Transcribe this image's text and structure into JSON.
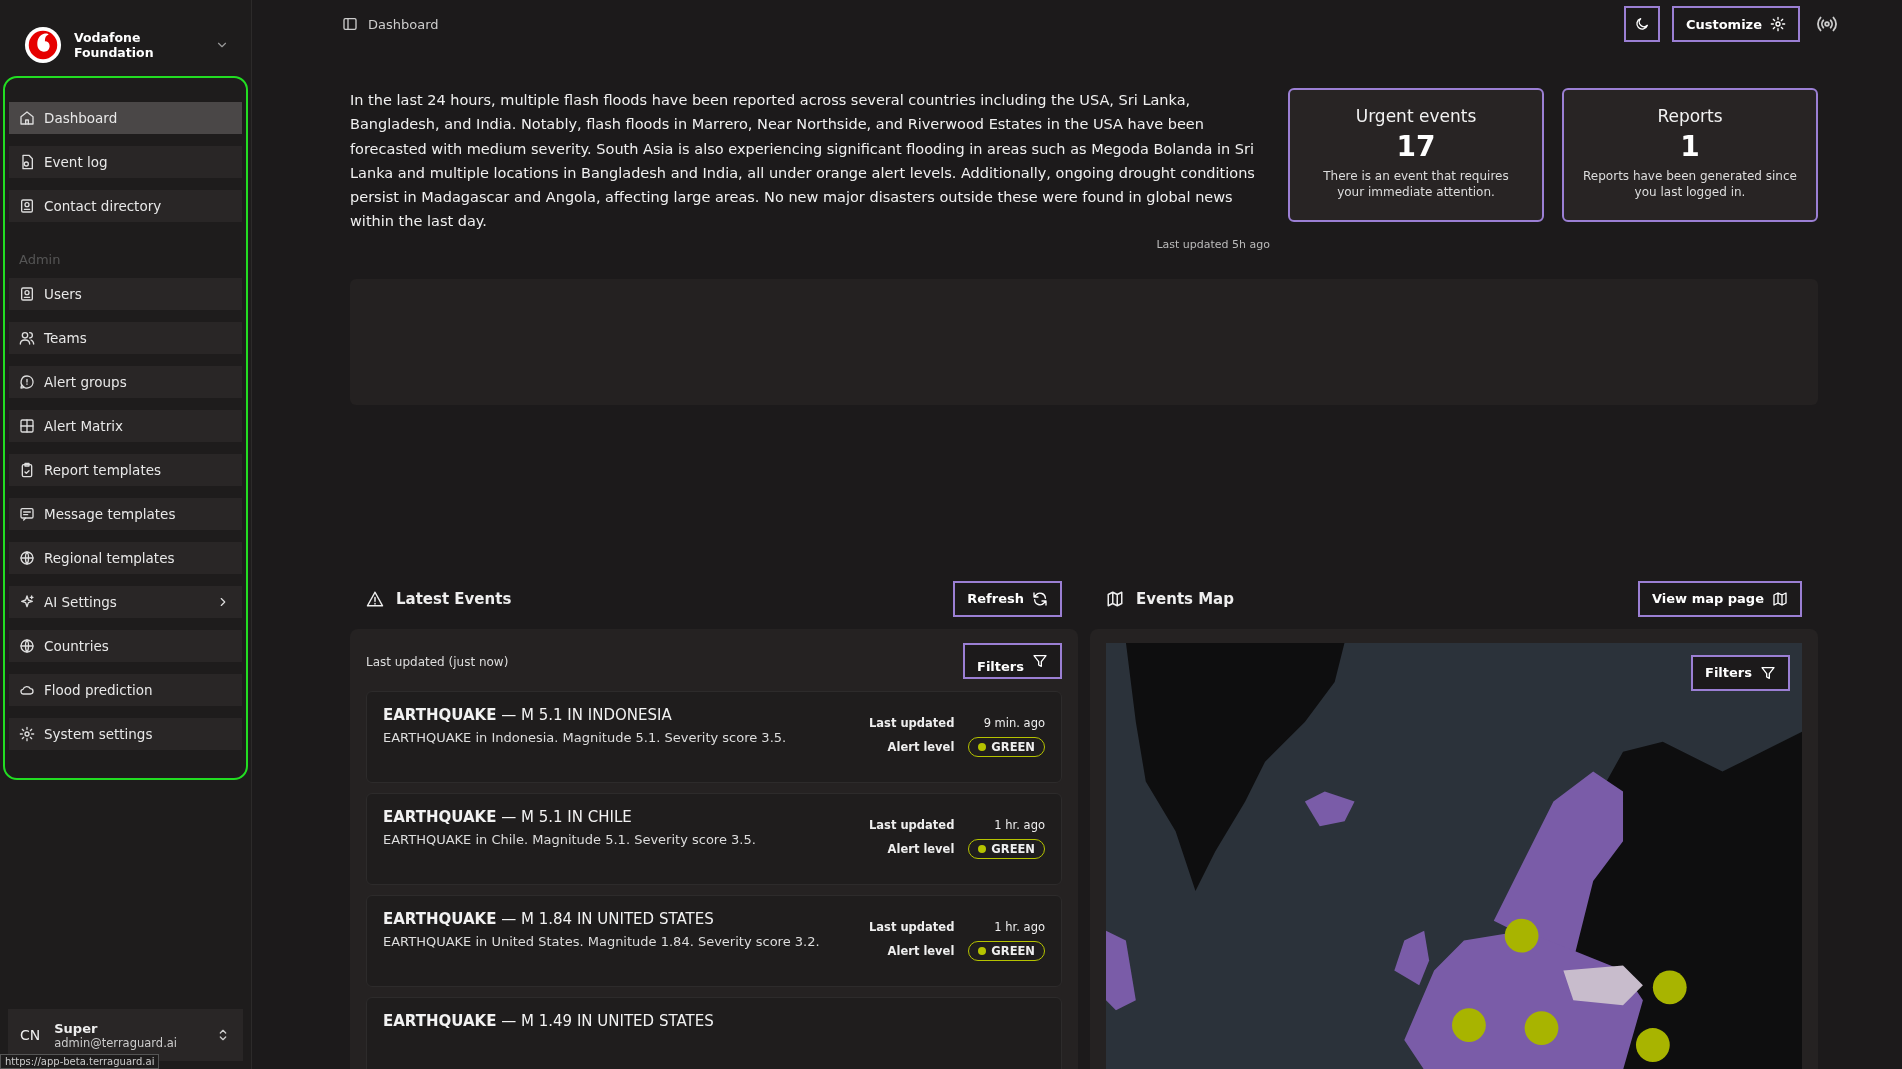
{
  "sidebar": {
    "org_name": "Vodafone Foundation",
    "nav": [
      {
        "label": "Dashboard",
        "selected": true,
        "expandable": false
      },
      {
        "label": "Event log",
        "selected": false,
        "expandable": false
      },
      {
        "label": "Contact directory",
        "selected": false,
        "expandable": false
      }
    ],
    "admin_heading": "Admin",
    "admin_nav": [
      {
        "label": "Users",
        "selected": false,
        "expandable": false
      },
      {
        "label": "Teams",
        "selected": false,
        "expandable": false
      },
      {
        "label": "Alert groups",
        "selected": false,
        "expandable": false
      },
      {
        "label": "Alert Matrix",
        "selected": false,
        "expandable": false
      },
      {
        "label": "Report templates",
        "selected": false,
        "expandable": false
      },
      {
        "label": "Message templates",
        "selected": false,
        "expandable": false
      },
      {
        "label": "Regional templates",
        "selected": false,
        "expandable": false
      },
      {
        "label": "AI Settings",
        "selected": false,
        "expandable": true
      },
      {
        "label": "Countries",
        "selected": false,
        "expandable": false
      },
      {
        "label": "Flood prediction",
        "selected": false,
        "expandable": false
      },
      {
        "label": "System settings",
        "selected": false,
        "expandable": false
      }
    ],
    "user": {
      "initials": "CN",
      "name": "Super",
      "email": "admin@terraguard.ai"
    }
  },
  "status_url": "https://app-beta.terraguard.ai",
  "header": {
    "breadcrumb": "Dashboard",
    "customize_button": "Customize"
  },
  "summary": {
    "text": "In the last 24 hours, multiple flash floods have been reported across several countries including the USA, Sri Lanka, Bangladesh, and India. Notably, flash floods in Marrero, Near Northside, and Riverwood Estates in the USA have been forecasted with medium severity. South Asia is also experiencing significant flooding in areas such as Megoda Bolanda in Sri Lanka and multiple locations in Bangladesh and India, all under orange alert levels. Additionally, ongoing drought conditions persist in Madagascar and Angola, affecting large areas. No new major disasters outside these were found in global news within the last day.",
    "last_updated": "Last updated 5h ago"
  },
  "stat_cards": [
    {
      "title": "Urgent events",
      "value": "17",
      "description": "There is an event that requires your immediate attention."
    },
    {
      "title": "Reports",
      "value": "1",
      "description": "Reports have been generated since you last logged in."
    }
  ],
  "latest_events": {
    "title": "Latest Events",
    "refresh_button": "Refresh",
    "last_updated": "Last updated (just now)",
    "filters_button": "Filters",
    "events": [
      {
        "title": "**EARTHQUAKE** — M 5.1 IN INDONESIA",
        "description": "EARTHQUAKE in Indonesia. Magnitude 5.1. Severity score 3.5.",
        "updated_label": "Last updated",
        "updated": "9 min. ago",
        "alert_label": "Alert level",
        "alert_level": "GREEN",
        "color": "#b5c300"
      },
      {
        "title": "**EARTHQUAKE** — M 5.1 IN CHILE",
        "description": "EARTHQUAKE in Chile. Magnitude 5.1. Severity score 3.5.",
        "updated_label": "Last updated",
        "updated": "1 hr. ago",
        "alert_label": "Alert level",
        "alert_level": "GREEN",
        "color": "#b5c300"
      },
      {
        "title": "**EARTHQUAKE** — M 1.84 IN UNITED STATES",
        "description": "EARTHQUAKE in United States. Magnitude 1.84. Severity score 3.2.",
        "updated_label": "Last updated",
        "updated": "1 hr. ago",
        "alert_label": "Alert level",
        "alert_level": "GREEN",
        "color": "#b5c300"
      },
      {
        "title": "**EARTHQUAKE** — M 1.49 IN UNITED STATES"
      }
    ]
  },
  "events_map": {
    "title": "Events Map",
    "view_button": "View map page",
    "filters_button": "Filters",
    "kind": "picture"
  }
}
